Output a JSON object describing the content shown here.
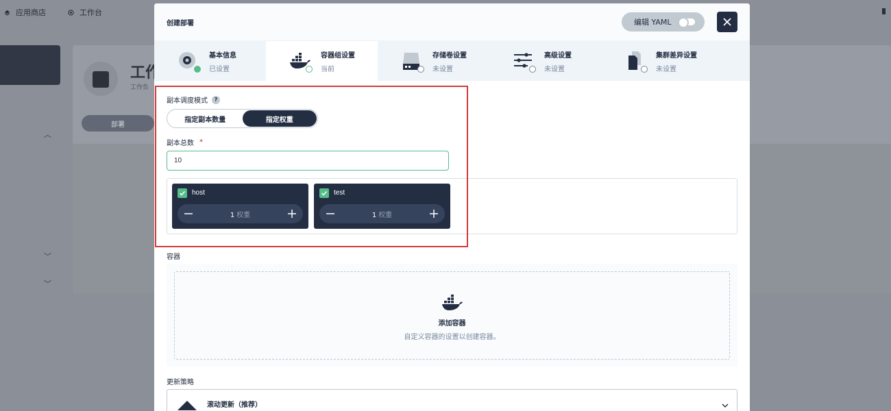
{
  "background": {
    "topbar": [
      {
        "label": "应用商店",
        "icon": "app-store-icon"
      },
      {
        "label": "工作台",
        "icon": "workbench-icon"
      }
    ],
    "panel_title": "工作",
    "panel_subtitle": "工作负",
    "pill_label": "部署"
  },
  "modal": {
    "title": "创建部署",
    "yaml_label": "编辑 YAML",
    "steps": [
      {
        "name": "基本信息",
        "status": "已设置",
        "icon": "disc-icon",
        "state": "done"
      },
      {
        "name": "容器组设置",
        "status": "当前",
        "icon": "docker-icon",
        "state": "current"
      },
      {
        "name": "存储卷设置",
        "status": "未设置",
        "icon": "storage-icon",
        "state": "pending"
      },
      {
        "name": "高级设置",
        "status": "未设置",
        "icon": "sliders-icon",
        "state": "pending"
      },
      {
        "name": "集群差异设置",
        "status": "未设置",
        "icon": "file-diff-icon",
        "state": "pending"
      }
    ],
    "schedule_mode": {
      "label": "副本调度模式",
      "options": [
        "指定副本数量",
        "指定权重"
      ],
      "selected": "指定权重"
    },
    "replicas_total": {
      "label": "副本总数",
      "required_mark": "*",
      "value": "10"
    },
    "weights": [
      {
        "cluster": "host",
        "value": "1",
        "unit": "权重",
        "checked": true
      },
      {
        "cluster": "test",
        "value": "1",
        "unit": "权重",
        "checked": true
      }
    ],
    "containers": {
      "label": "容器",
      "add_title": "添加容器",
      "add_desc": "自定义容器的设置以创建容器。"
    },
    "update_strategy": {
      "label": "更新策略",
      "value": "滚动更新（推荐）"
    }
  },
  "colors": {
    "dark": "#242e42",
    "accent_green": "#55bc8a",
    "highlight_red": "#d23a3a"
  }
}
